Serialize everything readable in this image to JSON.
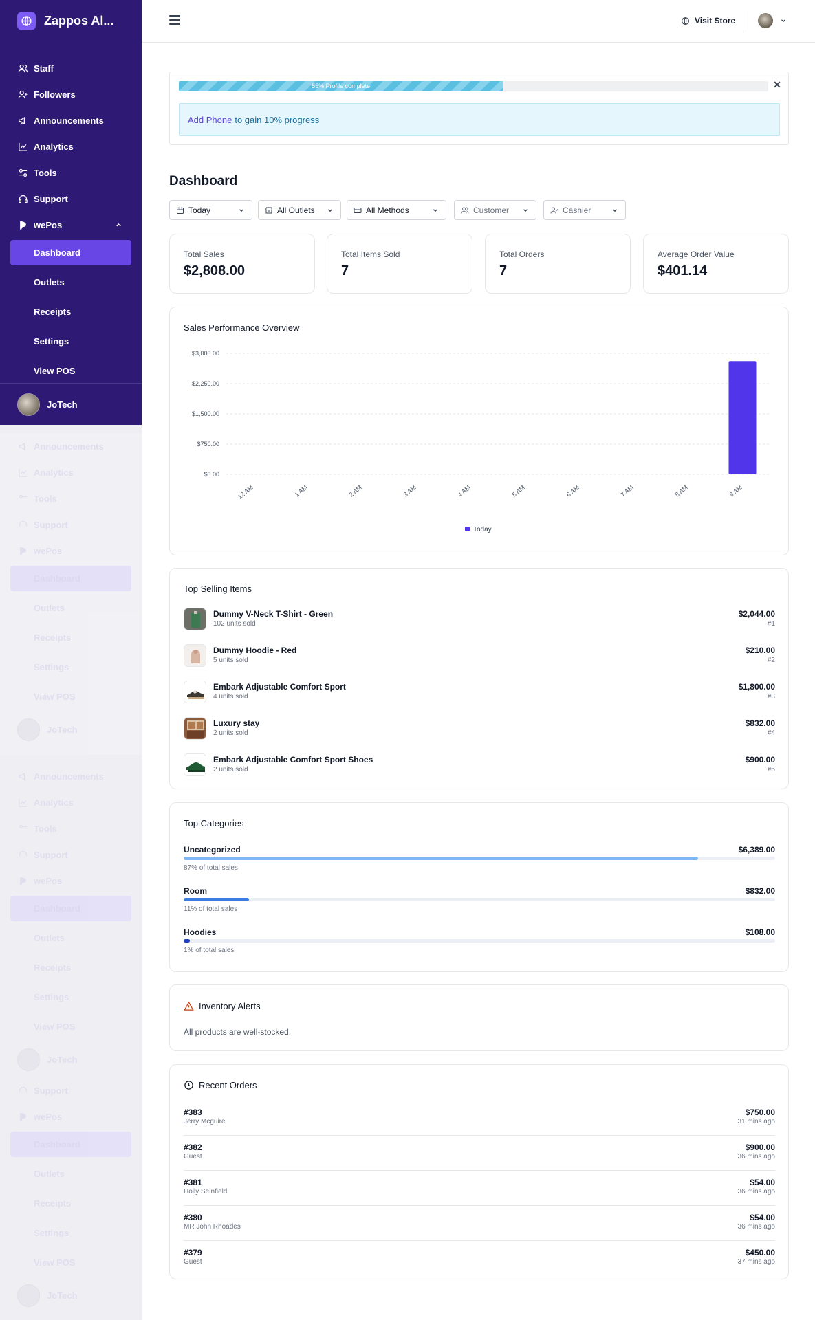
{
  "brand": {
    "title": "Zappos Al..."
  },
  "sidebar": {
    "items": [
      {
        "label": "Staff",
        "icon": "users-icon"
      },
      {
        "label": "Followers",
        "icon": "user-plus-icon"
      },
      {
        "label": "Announcements",
        "icon": "megaphone-icon"
      },
      {
        "label": "Analytics",
        "icon": "line-chart-icon"
      },
      {
        "label": "Tools",
        "icon": "sliders-icon"
      },
      {
        "label": "Support",
        "icon": "headphones-icon"
      },
      {
        "label": "wePos",
        "icon": "pos-icon"
      }
    ],
    "wepos_items": [
      {
        "label": "Dashboard",
        "active": true
      },
      {
        "label": "Outlets"
      },
      {
        "label": "Receipts"
      },
      {
        "label": "Settings"
      },
      {
        "label": "View POS"
      }
    ],
    "user": {
      "name": "JoTech"
    }
  },
  "topbar": {
    "visit_store": "Visit Store"
  },
  "profile": {
    "progress_label": "55% Profile complete",
    "progress": 0.55,
    "notice_link": "Add Phone",
    "notice_text": "to gain 10% progress"
  },
  "dashboard": {
    "title": "Dashboard",
    "filters": {
      "date": "Today",
      "outlet": "All Outlets",
      "method": "All Methods",
      "customer": "Customer",
      "cashier": "Cashier"
    },
    "stats": [
      {
        "label": "Total Sales",
        "value": "$2,808.00"
      },
      {
        "label": "Total Items Sold",
        "value": "7"
      },
      {
        "label": "Total Orders",
        "value": "7"
      },
      {
        "label": "Average Order Value",
        "value": "$401.14"
      }
    ]
  },
  "chart_data": {
    "type": "bar",
    "title": "Sales Performance Overview",
    "categories": [
      "12 AM",
      "1 AM",
      "2 AM",
      "3 AM",
      "4 AM",
      "5 AM",
      "6 AM",
      "7 AM",
      "8 AM",
      "9 AM"
    ],
    "series": [
      {
        "name": "Today",
        "values": [
          0,
          0,
          0,
          0,
          0,
          0,
          0,
          0,
          0,
          2808
        ],
        "color": "#5135ea"
      }
    ],
    "yticks": [
      "$0.00",
      "$750.00",
      "$1,500.00",
      "$2,250.00",
      "$3,000.00"
    ],
    "ylim": [
      0,
      3000
    ],
    "grid": true,
    "legend": "bottom-center"
  },
  "top_selling": {
    "title": "Top Selling Items",
    "items": [
      {
        "name": "Dummy V-Neck T-Shirt - Green",
        "sold": "102 units sold",
        "price": "$2,044.00",
        "rank": "#1"
      },
      {
        "name": "Dummy Hoodie - Red",
        "sold": "5 units sold",
        "price": "$210.00",
        "rank": "#2"
      },
      {
        "name": "Embark Adjustable Comfort Sport",
        "sold": "4 units sold",
        "price": "$1,800.00",
        "rank": "#3"
      },
      {
        "name": "Luxury stay",
        "sold": "2 units sold",
        "price": "$832.00",
        "rank": "#4"
      },
      {
        "name": "Embark Adjustable Comfort Sport Shoes",
        "sold": "2 units sold",
        "price": "$900.00",
        "rank": "#5"
      }
    ]
  },
  "top_categories": {
    "title": "Top Categories",
    "items": [
      {
        "name": "Uncategorized",
        "value": "$6,389.00",
        "pct_label": "87% of total sales",
        "share": 0.87,
        "color": "#7fb7f2"
      },
      {
        "name": "Room",
        "value": "$832.00",
        "pct_label": "11% of total sales",
        "share": 0.11,
        "color": "#3a7de8"
      },
      {
        "name": "Hoodies",
        "value": "$108.00",
        "pct_label": "1% of total sales",
        "share": 0.01,
        "color": "#1e3fc4"
      }
    ]
  },
  "inventory": {
    "title": "Inventory Alerts",
    "message": "All products are well-stocked."
  },
  "recent_orders": {
    "title": "Recent Orders",
    "orders": [
      {
        "id": "#383",
        "customer": "Jerry Mcguire",
        "amount": "$750.00",
        "time": "31 mins ago"
      },
      {
        "id": "#382",
        "customer": "Guest",
        "amount": "$900.00",
        "time": "36 mins ago"
      },
      {
        "id": "#381",
        "customer": "Holly Seinfield",
        "amount": "$54.00",
        "time": "36 mins ago"
      },
      {
        "id": "#380",
        "customer": "MR John Rhoades",
        "amount": "$54.00",
        "time": "36 mins ago"
      },
      {
        "id": "#379",
        "customer": "Guest",
        "amount": "$450.00",
        "time": "37 mins ago"
      }
    ]
  }
}
